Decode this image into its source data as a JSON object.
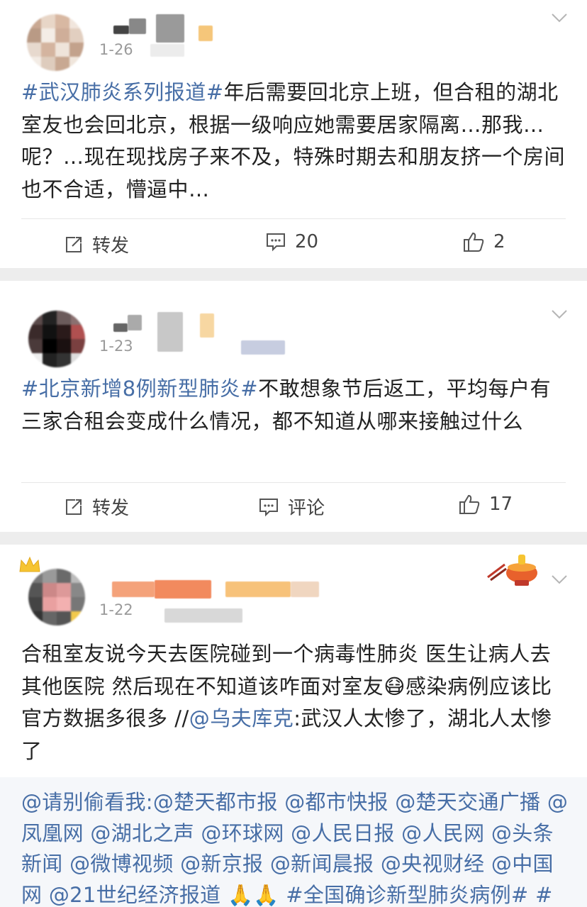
{
  "posts": [
    {
      "date": "1-26",
      "body": {
        "tag": "#武汉肺炎系列报道#",
        "text": "年后需要回北京上班，但合租的湖北室友也会回北京，根据一级响应她需要居家隔离…那我…呢？…现在现找房子来不及，特殊时期去和朋友挤一个房间也不合适，懵逼中…"
      },
      "actions": {
        "repost": "转发",
        "comments": "20",
        "likes": "2"
      }
    },
    {
      "date": "1-23",
      "body": {
        "tag": "#北京新增8例新型肺炎#",
        "text": "不敢想象节后返工，平均每户有三家合租会变成什么情况，都不知道从哪来接触过什么"
      },
      "actions": {
        "repost": "转发",
        "comments": "评论",
        "likes": "17"
      }
    },
    {
      "date": "1-22",
      "body": {
        "text": "合租室友说今天去医院碰到一个病毒性肺炎 医生让病人去其他医院 然后现在不知道该咋面对室友",
        "emoji": "😷",
        "text2": "感染病例应该比官方数据多很多 //",
        "mention": "@乌夫库克",
        "text3": ":武汉人太惨了，湖北人太惨了"
      },
      "quoted": "@请别偷看我:@楚天都市报 @都市快报 @楚天交通广播 @凤凰网 @湖北之声 @环球网 @人民日报 @人民网 @头条新闻 @微博视频 @新京报 @新闻晨报 @央视财经 @中国网 @21世纪经济报道 🙏🙏 #全国确诊新型肺炎病例# #"
    }
  ],
  "icons": [
    "repost-icon",
    "comment-icon",
    "like-icon",
    "chevron-down-icon",
    "hotpot-badge-icon",
    "crown-icon"
  ],
  "colors": {
    "link": "#476ea6",
    "meta": "#9a9a9a",
    "separator": "#ededed",
    "quoted_bg": "#f5f7fa"
  }
}
